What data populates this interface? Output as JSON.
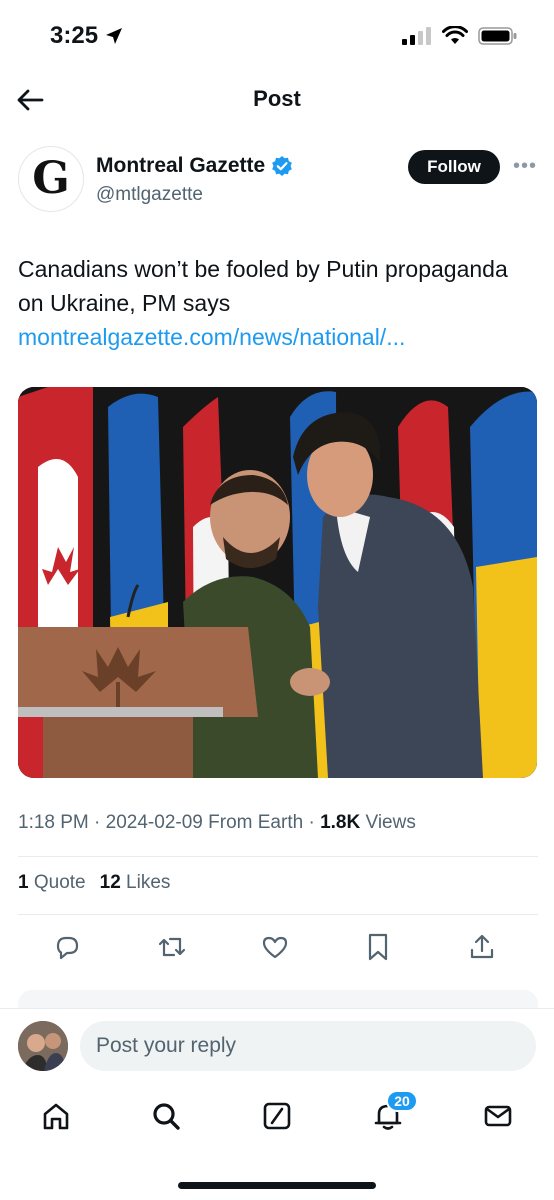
{
  "status_bar": {
    "time": "3:25"
  },
  "header": {
    "title": "Post"
  },
  "author": {
    "name": "Montreal Gazette",
    "handle": "@mtlgazette",
    "avatar_letter": "G",
    "follow_label": "Follow"
  },
  "post": {
    "text": "Canadians won’t be fooled by Putin propaganda on Ukraine, PM says",
    "link": "montrealgazette.com/news/national/..."
  },
  "meta": {
    "time": "1:18 PM",
    "date": "2024-02-09",
    "source": "From Earth",
    "views_count": "1.8K",
    "views_label": "Views"
  },
  "stats": {
    "quotes_count": "1",
    "quotes_label": "Quote",
    "likes_count": "12",
    "likes_label": "Likes"
  },
  "reply": {
    "placeholder": "Post your reply"
  },
  "tabbar": {
    "notifications_badge": "20"
  },
  "icons": {
    "location": "location-arrow-icon",
    "verified": "verified-badge-icon",
    "reply": "reply-icon",
    "repost": "repost-icon",
    "like": "heart-icon",
    "bookmark": "bookmark-icon",
    "share": "share-icon"
  },
  "colors": {
    "accent": "#1d9bf0",
    "text": "#0f1419",
    "secondary": "#536471"
  }
}
